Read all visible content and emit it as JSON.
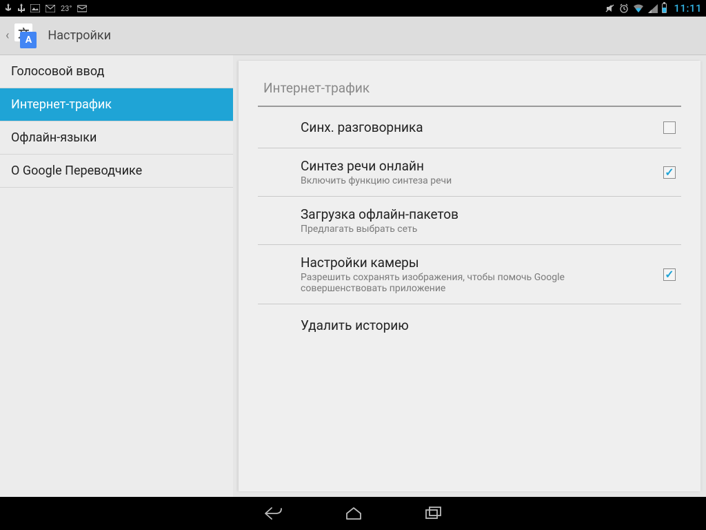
{
  "status": {
    "temp": "23°",
    "time": "11:11"
  },
  "actionbar": {
    "title": "Настройки"
  },
  "sidebar": {
    "items": [
      {
        "label": "Голосовой ввод",
        "selected": false
      },
      {
        "label": "Интернет-трафик",
        "selected": true
      },
      {
        "label": "Офлайн-языки",
        "selected": false
      },
      {
        "label": "О Google Переводчике",
        "selected": false
      }
    ]
  },
  "section": {
    "header": "Интернет-трафик",
    "rows": [
      {
        "title": "Синх. разговорника",
        "sub": "",
        "checkbox": true,
        "checked": false
      },
      {
        "title": "Синтез речи онлайн",
        "sub": "Включить функцию синтеза речи",
        "checkbox": true,
        "checked": true
      },
      {
        "title": "Загрузка офлайн-пакетов",
        "sub": "Предлагать выбрать сеть",
        "checkbox": false
      },
      {
        "title": "Настройки камеры",
        "sub": "Разрешить сохранять изображения, чтобы помочь Google совершенствовать приложение",
        "checkbox": true,
        "checked": true
      },
      {
        "title": "Удалить историю",
        "sub": "",
        "checkbox": false
      }
    ]
  }
}
